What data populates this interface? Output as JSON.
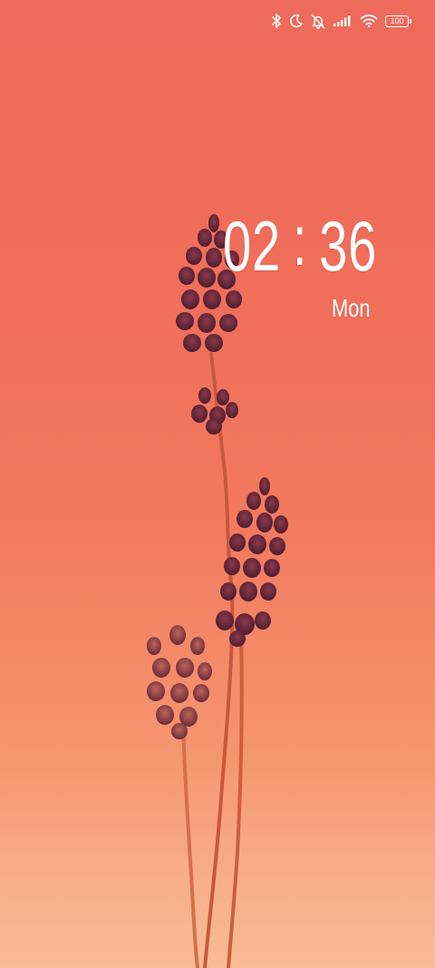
{
  "status_bar": {
    "icons": [
      "bluetooth-icon",
      "moon-icon",
      "bell-off-icon",
      "signal-icon",
      "wifi-icon",
      "battery-icon"
    ],
    "battery_level": "100"
  },
  "lock_screen": {
    "hours": "02",
    "separator": ":",
    "minutes": "36",
    "day": "Mon"
  },
  "colors": {
    "background_top": "#ee6a5a",
    "background_bottom": "#f9bb94",
    "flower": "#6e2a3a",
    "stem": "#c4583f",
    "text": "#ffffff"
  }
}
